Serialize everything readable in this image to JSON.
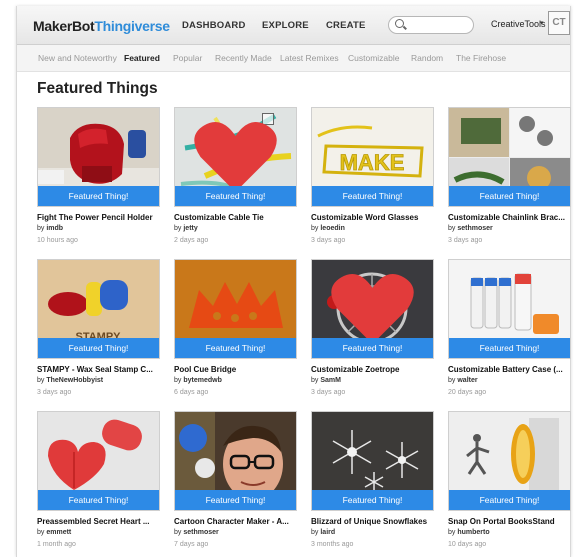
{
  "header": {
    "logo_part1": "MakerBot",
    "logo_part2": "Thingiverse",
    "nav": [
      "DASHBOARD",
      "EXPLORE",
      "CREATE"
    ],
    "search_placeholder": "",
    "user_name": "CreativeTools",
    "user_caret": "▾",
    "avatar_text": "CT"
  },
  "subnav": [
    "New and Noteworthy",
    "Featured",
    "Popular",
    "Recently Made",
    "Latest Remixes",
    "Customizable",
    "Random",
    "The Firehose"
  ],
  "subnav_active": "Featured",
  "page_title": "Featured Things",
  "banner_label": "Featured Thing!",
  "things": [
    {
      "title": "Fight The Power Pencil Holder",
      "by_prefix": "by",
      "author": "imdb",
      "ago": "10 hours ago",
      "liked": false
    },
    {
      "title": "Customizable Cable Tie",
      "by_prefix": "by",
      "author": "jetty",
      "ago": "2 days ago",
      "liked": true
    },
    {
      "title": "Customizable Word Glasses",
      "by_prefix": "by",
      "author": "leoedin",
      "ago": "3 days ago",
      "liked": false
    },
    {
      "title": "Customizable Chainlink Brac...",
      "by_prefix": "by",
      "author": "sethmoser",
      "ago": "3 days ago",
      "liked": false
    },
    {
      "title": "STAMPY - Wax Seal Stamp C...",
      "by_prefix": "by",
      "author": "TheNewHobbyist",
      "ago": "3 days ago",
      "liked": false
    },
    {
      "title": "Pool Cue Bridge",
      "by_prefix": "by",
      "author": "bytemedwb",
      "ago": "6 days ago",
      "liked": false
    },
    {
      "title": "Customizable Zoetrope",
      "by_prefix": "by",
      "author": "SamM",
      "ago": "3 days ago",
      "liked": true
    },
    {
      "title": "Customizable Battery Case (...",
      "by_prefix": "by",
      "author": "walter",
      "ago": "20 days ago",
      "liked": false
    },
    {
      "title": "Preassembled Secret Heart ...",
      "by_prefix": "by",
      "author": "emmett",
      "ago": "1 month ago",
      "liked": false
    },
    {
      "title": "Cartoon Character Maker - A...",
      "by_prefix": "by",
      "author": "sethmoser",
      "ago": "7 days ago",
      "liked": false
    },
    {
      "title": "Blizzard of Unique Snowflakes",
      "by_prefix": "by",
      "author": "laird",
      "ago": "3 months ago",
      "liked": false
    },
    {
      "title": "Snap On Portal BooksStand",
      "by_prefix": "by",
      "author": "humberto",
      "ago": "10 days ago",
      "liked": false
    }
  ],
  "image_text": {
    "glasses_word": "MAKE",
    "stamp_word": "STAMPY"
  },
  "colors": {
    "banner": "#2d8ae6",
    "brand_blue": "#2f8cd9",
    "heart": "#e23b3b"
  }
}
